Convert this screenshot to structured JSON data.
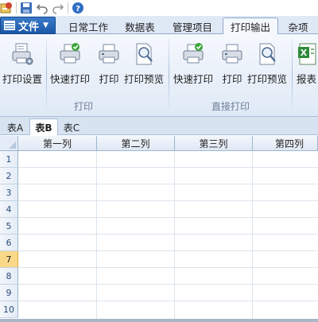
{
  "tabs": {
    "file": "文件",
    "items": [
      "日常工作",
      "数据表",
      "管理项目",
      "打印输出",
      "杂项"
    ],
    "active_index": 3
  },
  "ribbon": {
    "groups": [
      {
        "label": "打印",
        "buttons": [
          "打印设置",
          "快速打印",
          "打印",
          "打印预览"
        ]
      },
      {
        "label": "直接打印",
        "buttons": [
          "快速打印",
          "打印",
          "打印预览"
        ]
      },
      {
        "label": "",
        "buttons": [
          "报表"
        ]
      }
    ]
  },
  "sheet_tabs": {
    "items": [
      "表A",
      "表B",
      "表C"
    ],
    "active_index": 1
  },
  "grid": {
    "columns": [
      "第一列",
      "第二列",
      "第三列",
      "第四列"
    ],
    "rows": [
      "1",
      "2",
      "3",
      "4",
      "5",
      "6",
      "7",
      "8",
      "9",
      "10"
    ],
    "selected_row": "7"
  },
  "colors": {
    "accent": "#1b58a8",
    "ribbon_bg": "#dfe9f6",
    "selected_row_header": "#f9d888"
  }
}
